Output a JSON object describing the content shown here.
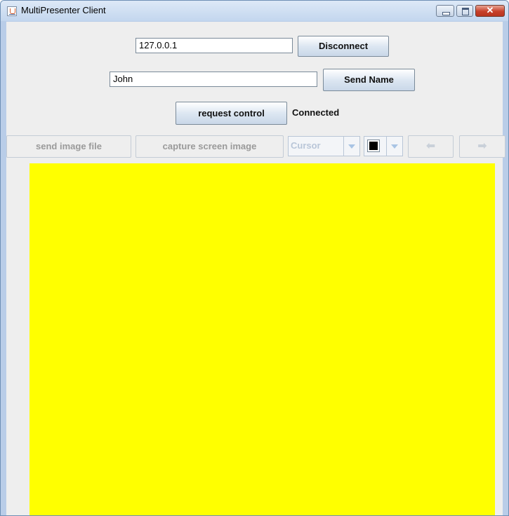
{
  "window": {
    "title": "MultiPresenter Client",
    "close_glyph": "✕"
  },
  "connection": {
    "host_value": "127.0.0.1",
    "disconnect_label": "Disconnect",
    "name_value": "John",
    "send_name_label": "Send Name",
    "request_control_label": "request control",
    "status_text": "Connected"
  },
  "toolbar": {
    "send_image_label": "send image file",
    "capture_label": "capture screen image",
    "tool_selected": "Cursor",
    "color_selected": "#000000",
    "prev_glyph": "⬅",
    "next_glyph": "➡"
  },
  "canvas": {
    "background": "#ffff00"
  }
}
